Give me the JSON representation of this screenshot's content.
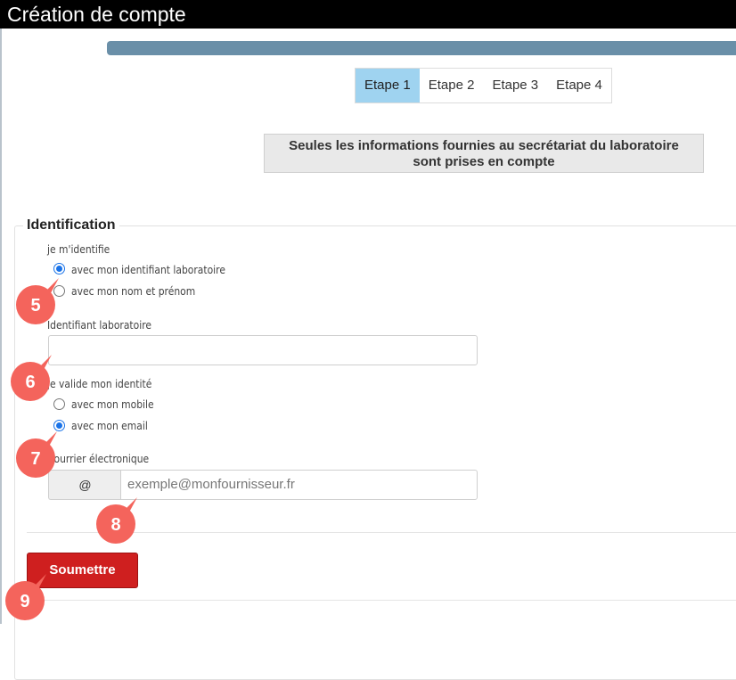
{
  "window": {
    "title": "Création de compte"
  },
  "steps": [
    "Etape 1",
    "Etape 2",
    "Etape 3",
    "Etape 4"
  ],
  "active_step": "Etape 1",
  "notice": {
    "line1": "Seules les informations fournies au secrétariat du laboratoire",
    "line2": "sont prises en compte"
  },
  "form": {
    "legend": "Identification",
    "identify": {
      "label": "je m'identifie",
      "options": [
        "avec mon identifiant laboratoire",
        "avec mon nom et prénom"
      ],
      "selected": "avec mon identifiant laboratoire"
    },
    "lab_id": {
      "label": "Identifiant laboratoire",
      "value": ""
    },
    "validate": {
      "label": "je valide mon identité",
      "options": [
        "avec mon mobile",
        "avec mon email"
      ],
      "selected": "avec mon email"
    },
    "email": {
      "label": "Courrier électronique",
      "addon": "@",
      "placeholder": "exemple@monfournisseur.fr",
      "value": ""
    },
    "submit_label": "Soumettre"
  },
  "annotations": [
    "5",
    "6",
    "7",
    "8",
    "9"
  ],
  "colors": {
    "progress": "#6a8fa8",
    "active_step": "#9fd3f0",
    "submit": "#cf1f1f",
    "marker": "#f4645c"
  }
}
